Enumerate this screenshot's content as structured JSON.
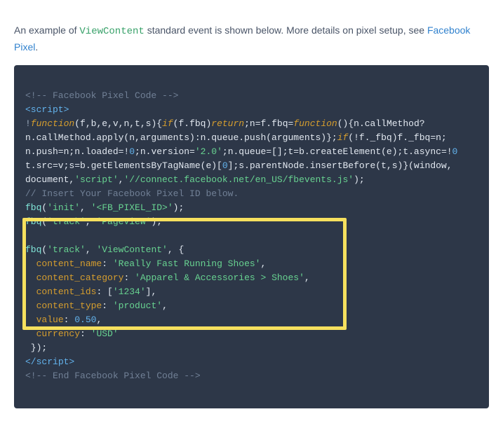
{
  "intro": {
    "t1": "An example of ",
    "code_inline": "ViewContent",
    "t2": " standard event is shown below. More details on pixel setup, see ",
    "link": "Facebook Pixel",
    "t3": "."
  },
  "code": {
    "l1_cmt": "<!-- Facebook Pixel Code -->",
    "l2_tag_o": "<script>",
    "l3_op1": "!",
    "l3_kw_fn": "function",
    "l3_args": "(f,b,e,v,n,t,s){",
    "l3_kw_if": "if",
    "l3_cond": "(f.fbq)",
    "l3_kw_ret": "return",
    "l3_after_ret": ";n=f.fbq=",
    "l3_kw_fn2": "function",
    "l3_tail": "(){n.callMethod?",
    "l4": "n.callMethod.apply(n,arguments):n.queue.push(arguments)};",
    "l4_kw_if": "if",
    "l4_cond": "(!f._fbq)f._fbq=n;",
    "l5_a": "n.push=n;n.loaded=!",
    "l5_num0": "0",
    "l5_b": ";n.version=",
    "l5_str_ver": "'2.0'",
    "l5_c": ";n.queue=[];t=b.createElement(e);t.async=!",
    "l5_num0b": "0",
    "l6_a": "t.src=v;s=b.getElementsByTagName(e)[",
    "l6_num0": "0",
    "l6_b": "];s.parentNode.insertBefore(t,s)}(window,",
    "l7_a": "document,",
    "l7_str_script": "'script'",
    "l7_b": ",",
    "l7_str_url": "'//connect.facebook.net/en_US/fbevents.js'",
    "l7_c": ");",
    "l8_cmt": "// Insert Your Facebook Pixel ID below.",
    "l9_fn": "fbq",
    "l9_a": "(",
    "l9_s1": "'init'",
    "l9_b": ", ",
    "l9_s2": "'<FB_PIXEL_ID>'",
    "l9_c": ");",
    "l10_fn": "fbq",
    "l10_a": "(",
    "l10_s1": "'track'",
    "l10_b": ", ",
    "l10_s2": "'PageView'",
    "l10_c": ");",
    "l12_fn": "fbq",
    "l12_a": "(",
    "l12_s1": "'track'",
    "l12_b": ", ",
    "l12_s2": "'ViewContent'",
    "l12_c": ", {",
    "l13_k": "content_name",
    "l13_v": "'Really Fast Running Shoes'",
    "l14_k": "content_category",
    "l14_v": "'Apparel & Accessories > Shoes'",
    "l15_k": "content_ids",
    "l15_b": ": [",
    "l15_v": "'1234'",
    "l15_c": "],",
    "l16_k": "content_type",
    "l16_v": "'product'",
    "l17_k": "value",
    "l17_v": "0.50",
    "l18_k": "currency",
    "l18_v": "'USD'",
    "l19": " });",
    "l20_tag_c": "</scr",
    "l20_tag_c2": "ipt>",
    "l21_cmt": "<!-- End Facebook Pixel Code -->"
  }
}
